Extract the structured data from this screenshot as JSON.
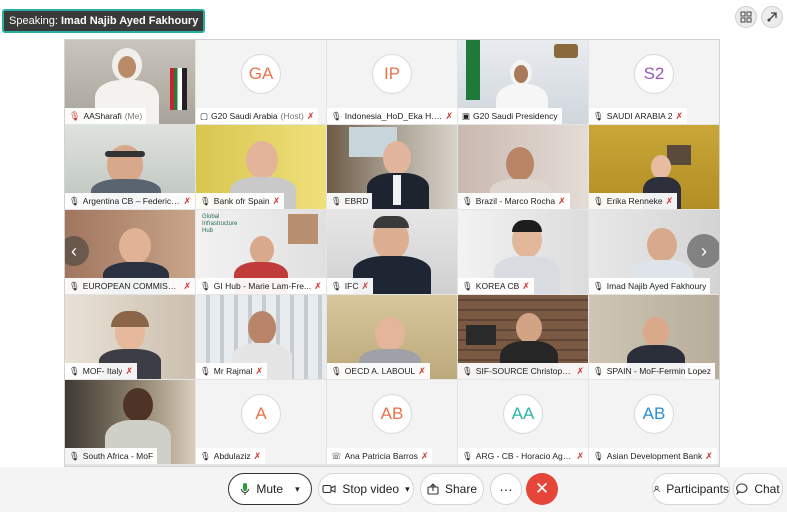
{
  "speaking": {
    "prefix": "Speaking: ",
    "name": "Imad Najib Ayed Fakhoury"
  },
  "tiles": [
    {
      "name": "AASharafi",
      "sub": "(Me)"
    },
    {
      "initials": "GA",
      "color": "#e8734a",
      "name": "G20 Saudi Arabia",
      "sub": "(Host)"
    },
    {
      "initials": "IP",
      "color": "#e8734a",
      "name": "Indonesia_HoD_Eka H. P..."
    },
    {
      "name": "G20 Saudi Presidency"
    },
    {
      "initials": "S2",
      "color": "#9b59b6",
      "name": "SAUDI ARABIA 2"
    },
    {
      "name": "Argentina CB – Federico..."
    },
    {
      "name": "Bank ofr Spain"
    },
    {
      "name": "EBRD"
    },
    {
      "name": "Brazil - Marco Rocha"
    },
    {
      "name": "Erika Renneke"
    },
    {
      "name": "EUROPEAN COMMISSION"
    },
    {
      "name": "GI Hub - Marie Lam-Fre..."
    },
    {
      "name": "IFC"
    },
    {
      "name": "KOREA CB"
    },
    {
      "name": "Imad Najib Ayed Fakhoury"
    },
    {
      "name": "MOF- Italy"
    },
    {
      "name": "Mr Rajmal"
    },
    {
      "name": "OECD A. LABOUL"
    },
    {
      "name": "SIF-SOURCE Christophe ..."
    },
    {
      "name": "SPAIN - MoF-Fermin Lopez"
    },
    {
      "name": "South Africa - MoF"
    },
    {
      "initials": "A",
      "color": "#e8734a",
      "name": "Abdulaziz"
    },
    {
      "initials": "AB",
      "color": "#e8734a",
      "name": "Ana Patricia Barros"
    },
    {
      "initials": "AA",
      "color": "#2bb5a3",
      "name": "ARG - CB - Horacio Agu..."
    },
    {
      "initials": "AB",
      "color": "#2b8fd6",
      "name": "Asian Development Bank"
    }
  ],
  "gi_hub_sign": "Global Infrastructure Hub",
  "toolbar": {
    "mute": "Mute",
    "stop_video": "Stop video",
    "share": "Share",
    "more": "…",
    "end": "✕",
    "participants": "Participants",
    "chat": "Chat"
  },
  "nav": {
    "prev": "‹",
    "next": "›"
  },
  "colors": {
    "accent": "#27b8d6",
    "end": "#e6453a",
    "mute_icon": "#2e9c3a"
  }
}
